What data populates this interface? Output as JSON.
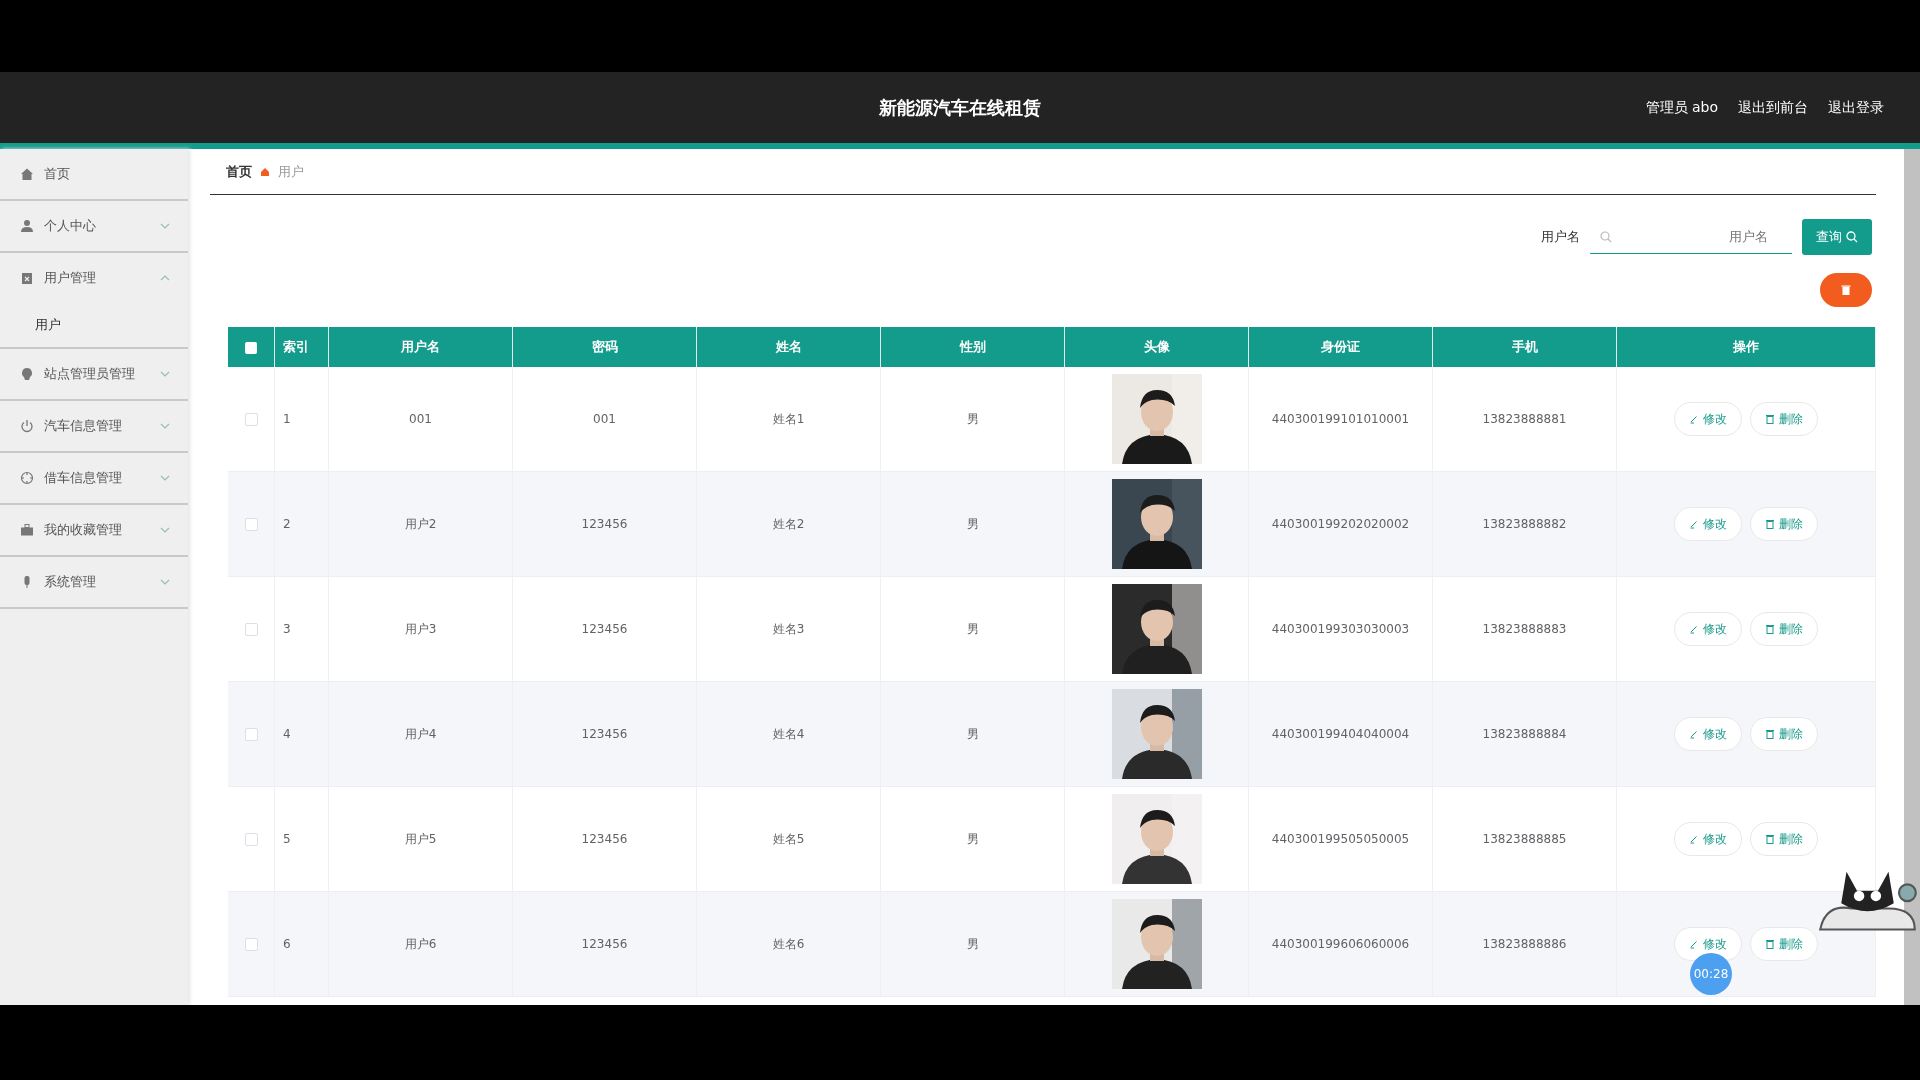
{
  "header": {
    "title": "新能源汽车在线租赁",
    "links": [
      "管理员 abo",
      "退出到前台",
      "退出登录"
    ]
  },
  "sidebar": {
    "items": [
      {
        "label": "首页",
        "kind": "link"
      },
      {
        "label": "个人中心",
        "kind": "menu",
        "expanded": false
      },
      {
        "label": "用户管理",
        "kind": "menu",
        "expanded": true,
        "children": [
          {
            "label": "用户"
          }
        ]
      },
      {
        "label": "站点管理员管理",
        "kind": "menu",
        "expanded": false
      },
      {
        "label": "汽车信息管理",
        "kind": "menu",
        "expanded": false
      },
      {
        "label": "借车信息管理",
        "kind": "menu",
        "expanded": false
      },
      {
        "label": "我的收藏管理",
        "kind": "menu",
        "expanded": false
      },
      {
        "label": "系统管理",
        "kind": "menu",
        "expanded": false
      }
    ]
  },
  "breadcrumb": [
    "首页",
    "用户"
  ],
  "search": {
    "label": "用户名",
    "placeholder": "用户名",
    "button": "查询"
  },
  "table": {
    "select_all": {
      "checked": false
    },
    "columns": [
      "索引",
      "用户名",
      "密码",
      "姓名",
      "性别",
      "头像",
      "身份证",
      "手机",
      "操作"
    ],
    "rows": [
      {
        "checked": false,
        "cells": [
          "1",
          "001",
          "001",
          "姓名1",
          "男"
        ],
        "actions": [
          "修改",
          "删除"
        ],
        "avatar": {
          "kind": "picture"
        },
        "id_card": "440300199101010001",
        "phone": "13823888881"
      },
      {
        "checked": false,
        "cells": [
          "2",
          "用户2",
          "123456",
          "姓名2",
          "男"
        ],
        "actions": [
          "修改",
          "删除"
        ],
        "avatar": {
          "kind": "picture"
        },
        "id_card": "440300199202020002",
        "phone": "13823888882"
      },
      {
        "checked": false,
        "cells": [
          "3",
          "用户3",
          "123456",
          "姓名3",
          "男"
        ],
        "actions": [
          "修改",
          "删除"
        ],
        "avatar": {
          "kind": "picture"
        },
        "id_card": "440300199303030003",
        "phone": "13823888883"
      },
      {
        "checked": false,
        "cells": [
          "4",
          "用户4",
          "123456",
          "姓名4",
          "男"
        ],
        "actions": [
          "修改",
          "删除"
        ],
        "avatar": {
          "kind": "picture"
        },
        "id_card": "440300199404040004",
        "phone": "13823888884"
      },
      {
        "checked": false,
        "cells": [
          "5",
          "用户5",
          "123456",
          "姓名5",
          "男"
        ],
        "actions": [
          "修改",
          "删除"
        ],
        "avatar": {
          "kind": "picture"
        },
        "id_card": "440300199505050005",
        "phone": "13823888885"
      },
      {
        "checked": false,
        "cells": [
          "6",
          "用户6",
          "123456",
          "姓名6",
          "男"
        ],
        "actions": [
          "修改",
          "删除"
        ],
        "avatar": {
          "kind": "picture"
        },
        "id_card": "440300199606060006",
        "phone": "13823888886"
      }
    ]
  },
  "timer": "00:28"
}
